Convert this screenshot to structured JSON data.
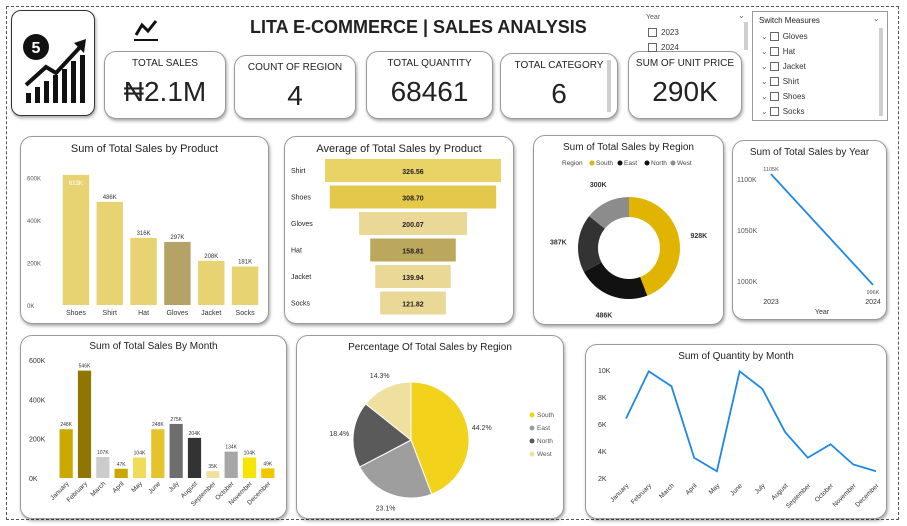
{
  "title": "LITA E-COMMERCE | SALES ANALYSIS",
  "kpis": [
    {
      "label": "TOTAL SALES",
      "value": "₦2.1M"
    },
    {
      "label": "COUNT OF REGION",
      "value": "4"
    },
    {
      "label": "TOTAL QUANTITY",
      "value": "68461"
    },
    {
      "label": "TOTAL CATEGORY",
      "value": "6"
    },
    {
      "label": "SUM OF UNIT PRICE",
      "value": "290K"
    }
  ],
  "year_slicer": {
    "label": "Year",
    "options": [
      "2023",
      "2024"
    ]
  },
  "measures_slicer": {
    "label": "Switch Measures",
    "options": [
      "Gloves",
      "Hat",
      "Jacket",
      "Shirt",
      "Shoes",
      "Socks"
    ]
  },
  "colors": {
    "yellow": "#f2d21b",
    "dark_olive": "#a68c00",
    "grey": "#8c8c8c",
    "black": "#111111",
    "blue": "#1e88e5"
  },
  "chart_data": [
    {
      "id": "sales_by_product",
      "type": "bar",
      "title": "Sum of Total Sales by Product",
      "categories": [
        "Shoes",
        "Shirt",
        "Hat",
        "Gloves",
        "Jacket",
        "Socks"
      ],
      "values": [
        613,
        486,
        316,
        297,
        208,
        181
      ],
      "labels": [
        "613K",
        "486K",
        "316K",
        "297K",
        "208K",
        "181K"
      ],
      "colors": [
        "#e8d373",
        "#e8d373",
        "#e8d373",
        "#b5a266",
        "#e8d373",
        "#e8d373"
      ],
      "yticks": [
        "0K",
        "200K",
        "400K",
        "600K"
      ],
      "ylim": [
        0,
        650
      ]
    },
    {
      "id": "avg_sales_by_product",
      "type": "bar",
      "title": "Average of Total Sales by Product",
      "categories": [
        "Shirt",
        "Shoes",
        "Gloves",
        "Hat",
        "Jacket",
        "Socks"
      ],
      "values": [
        326.56,
        308.7,
        200.07,
        158.81,
        139.94,
        121.82
      ],
      "labels": [
        "326.56",
        "308.70",
        "200.07",
        "158.81",
        "139.94",
        "121.82"
      ],
      "colors": [
        "#e9d266",
        "#e3c84a",
        "#ead897",
        "#bba85c",
        "#ead897",
        "#ead897"
      ]
    },
    {
      "id": "sales_by_region_donut",
      "type": "pie",
      "title": "Sum of Total Sales by Region",
      "legend_title": "Region",
      "categories": [
        "South",
        "East",
        "North",
        "West"
      ],
      "values": [
        928,
        486,
        387,
        300
      ],
      "labels": [
        "928K",
        "486K",
        "387K",
        "300K"
      ],
      "colors": [
        "#e0b400",
        "#111111",
        "#333333",
        "#8c8c8c"
      ],
      "legend_colors": [
        "#e0b400",
        "#111111",
        "#111111",
        "#8c8c8c"
      ]
    },
    {
      "id": "sales_by_year",
      "type": "line",
      "title": "Sum of Total Sales by Year",
      "x": [
        "2023",
        "2024"
      ],
      "values": [
        1105,
        996
      ],
      "labels": [
        "1105K",
        "996K"
      ],
      "xlabel": "Year",
      "yticks": [
        "1000K",
        "1050K",
        "1100K"
      ],
      "ylim": [
        990,
        1110
      ]
    },
    {
      "id": "sales_by_month",
      "type": "bar",
      "title": "Sum of Total Sales By Month",
      "categories": [
        "January",
        "February",
        "March",
        "April",
        "May",
        "June",
        "July",
        "August",
        "September",
        "October",
        "November",
        "December"
      ],
      "values": [
        248,
        546,
        107,
        47,
        104,
        248,
        275,
        204,
        35,
        134,
        104,
        49
      ],
      "labels": [
        "248K",
        "546K",
        "107K",
        "47K",
        "104K",
        "248K",
        "275K",
        "204K",
        "35K",
        "134K",
        "104K",
        "49K"
      ],
      "colors": [
        "#c9a800",
        "#8f7600",
        "#cccccc",
        "#c9a800",
        "#f0db5a",
        "#e6c22c",
        "#6e6e6e",
        "#333333",
        "#f0e0a0",
        "#a6a6a6",
        "#f5e500",
        "#f0c800"
      ],
      "yticks": [
        "0K",
        "200K",
        "400K",
        "600K"
      ],
      "ylim": [
        0,
        600
      ]
    },
    {
      "id": "pct_sales_by_region",
      "type": "pie",
      "title": "Percentage Of Total Sales by Region",
      "categories": [
        "South",
        "East",
        "North",
        "West"
      ],
      "values": [
        44.2,
        23.1,
        18.4,
        14.3
      ],
      "labels": [
        "44.2%",
        "23.1%",
        "18.4%",
        "14.3%"
      ],
      "colors": [
        "#f2d21b",
        "#9e9e9e",
        "#5a5a5a",
        "#efe0a0"
      ]
    },
    {
      "id": "quantity_by_month",
      "type": "line",
      "title": "Sum of Quantity by Month",
      "x": [
        "January",
        "February",
        "March",
        "April",
        "May",
        "June",
        "July",
        "August",
        "September",
        "October",
        "November",
        "December"
      ],
      "values": [
        6400,
        9900,
        8800,
        3500,
        2500,
        9900,
        8600,
        5400,
        3500,
        4500,
        3000,
        2500
      ],
      "yticks": [
        "2K",
        "4K",
        "6K",
        "8K",
        "10K"
      ],
      "ylim": [
        2000,
        10000
      ]
    }
  ]
}
